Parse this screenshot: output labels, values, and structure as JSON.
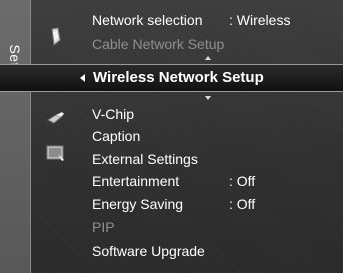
{
  "sidebar": {
    "tab_label": "Setup"
  },
  "menu": {
    "network_selection": {
      "label": "Network selection",
      "value": ": Wireless"
    },
    "cable_network_setup": {
      "label": "Cable Network Setup"
    },
    "wireless_network_setup": {
      "label": "Wireless Network Setup"
    },
    "v_chip": {
      "label": "V-Chip"
    },
    "caption": {
      "label": "Caption"
    },
    "external_settings": {
      "label": "External Settings"
    },
    "entertainment": {
      "label": "Entertainment",
      "value": ": Off"
    },
    "energy_saving": {
      "label": "Energy Saving",
      "value": ": Off"
    },
    "pip": {
      "label": "PIP"
    },
    "software_upgrade": {
      "label": "Software Upgrade"
    }
  },
  "colors": {
    "text": "#ffffff",
    "disabled_text": "#8f8f8f",
    "highlight_border": "#9a9a9a"
  }
}
